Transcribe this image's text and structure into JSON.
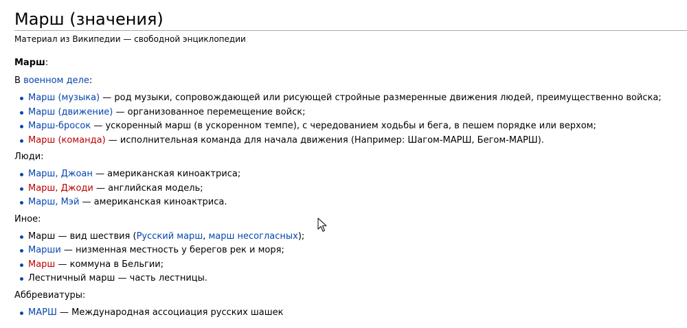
{
  "title": "Марш (значения)",
  "subtitle": "Материал из Википедии — свободной энциклопедии",
  "intro_bold": "Марш",
  "intro_colon": ":",
  "military": {
    "prefix": "В ",
    "link": "военном деле",
    "suffix": ":"
  },
  "military_items": [
    {
      "link": "Марш (музыка)",
      "text": " — род музыки, сопровождающей или рисующей стройные размеренные движения людей, преимущественно войска;"
    },
    {
      "link": "Марш (движение)",
      "text": " — организованное перемещение войск;"
    },
    {
      "link": "Марш-бросок",
      "text": " — ускоренный марш (в ускоренном темпе), с чередованием ходьбы и бега, в пешем порядке или верхом;"
    },
    {
      "link": "Марш (команда)",
      "text": " — исполнительная команда для начала движения (Например: Шагом-МАРШ, Бегом-МАРШ)."
    }
  ],
  "people_heading": "Люди:",
  "people_items": [
    {
      "link": "Марш, Джоан",
      "text": " — американская киноактриса;"
    },
    {
      "link": "Марш, Джоди",
      "text": " — английская модель;"
    },
    {
      "link": "Марш, Мэй",
      "text": " — американская киноактриса."
    }
  ],
  "other_heading": "Иное:",
  "other_items": {
    "march": {
      "prefix": "Марш — вид шествия (",
      "link1": "Русский марш",
      "sep": ", ",
      "link2": "марш несогласных",
      "suffix": ");"
    },
    "marshi": {
      "link": "Марши",
      "text": " — низменная местность у берегов рек и моря;"
    },
    "commune": {
      "link": "Марш",
      "text": " — коммуна в Бельгии;"
    },
    "stair": {
      "text": "Лестничный марш — часть лестницы."
    }
  },
  "abbr_heading": "Аббревиатуры:",
  "abbr_items": [
    {
      "link": "МАРШ",
      "text": " — Международная ассоциация русских шашек"
    }
  ],
  "colors": {
    "link": "#0645ad",
    "redlink": "#ba0000",
    "rule": "#aaaaaa"
  }
}
